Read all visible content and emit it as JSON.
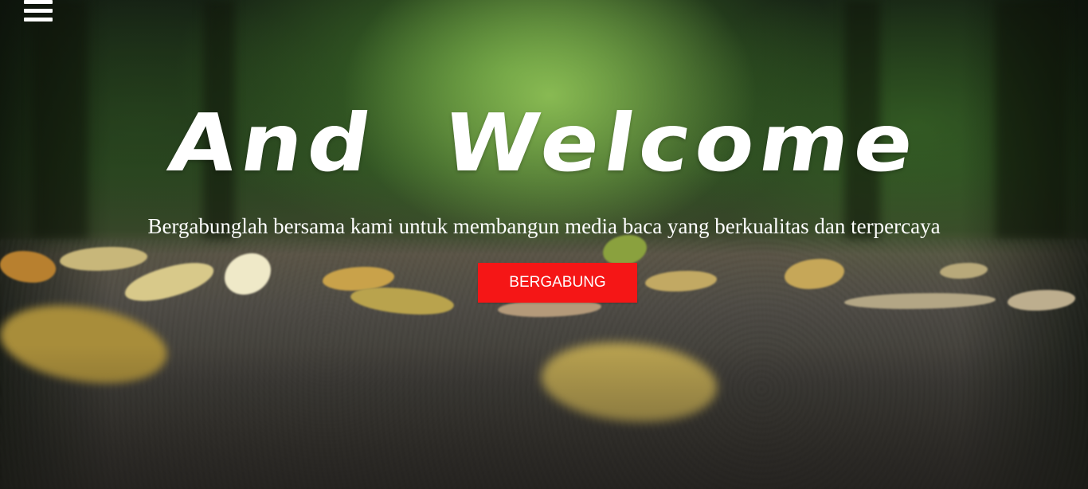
{
  "nav": {
    "menu_icon": "hamburger-menu-icon"
  },
  "hero": {
    "title": "And Welcome",
    "subtitle": "Bergabunglah bersama kami untuk membangun media baca yang berkualitas dan terpercaya",
    "cta_label": "BERGABUNG",
    "background_image": "blurred forest path with fallen autumn leaves"
  },
  "colors": {
    "cta_background": "#f51616",
    "text": "#ffffff"
  }
}
